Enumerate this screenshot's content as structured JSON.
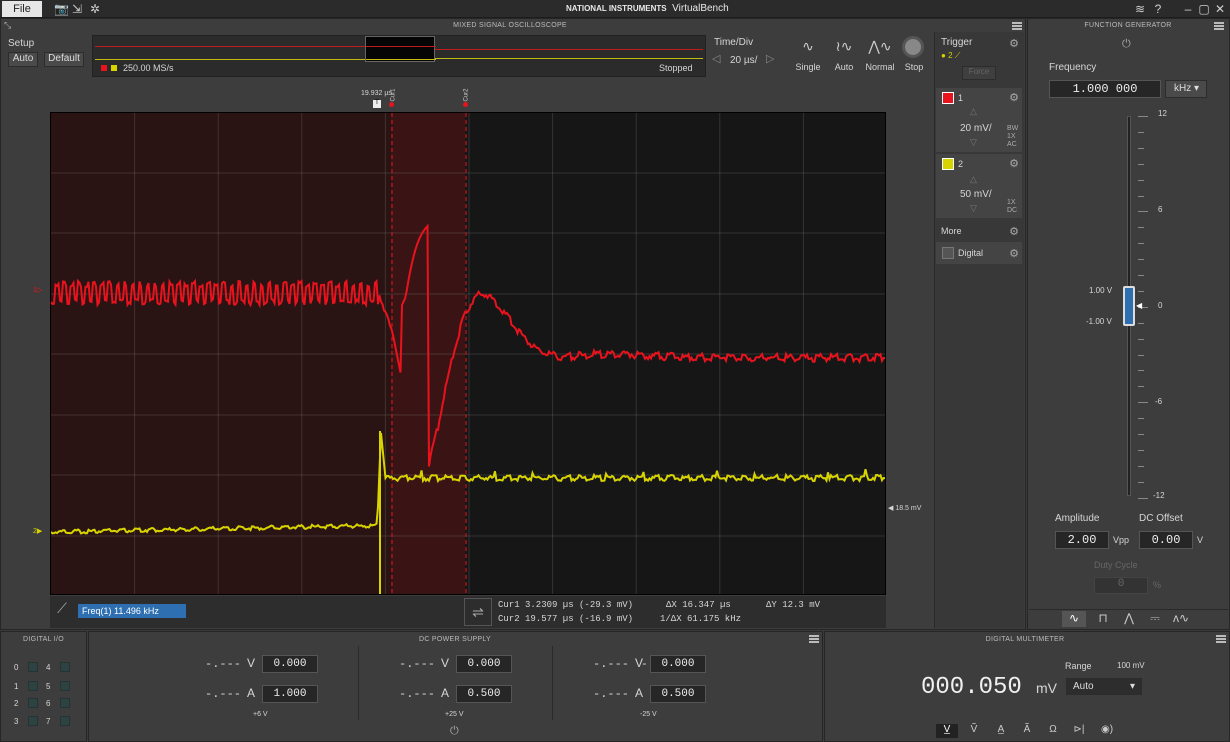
{
  "app": {
    "menu_file": "File",
    "title": "VirtualBench",
    "logo": "NATIONAL INSTRUMENTS"
  },
  "scope": {
    "panel_title": "MIXED SIGNAL OSCILLOSCOPE",
    "setup_label": "Setup",
    "auto_btn": "Auto",
    "default_btn": "Default",
    "sample_rate": "250.00 MS/s",
    "status": "Stopped",
    "timediv_label": "Time/Div",
    "timediv_value": "20 µs/",
    "modes": [
      "Single",
      "Auto",
      "Normal",
      "Stop"
    ],
    "trigger_label": "Trigger",
    "trigger_source": "2",
    "force_btn": "Force",
    "trigger_time": "19.932 µs",
    "trigger_level": "18.5 mV",
    "ch1": {
      "label": "1",
      "scale": "20 mV/",
      "bw": "BW",
      "probe": "1X",
      "coupling": "AC",
      "marker": "1",
      "color": "#e8131d"
    },
    "ch2": {
      "label": "2",
      "scale": "50 mV/",
      "probe": "1X",
      "coupling": "DC",
      "marker": "2",
      "color": "#d8d400"
    },
    "more_label": "More",
    "digital_label": "Digital",
    "cursor_labels": [
      "Cur1",
      "Cur2"
    ],
    "measure": {
      "label": "Freq(1)",
      "value": "11.496  kHz"
    },
    "cur1": "Cur1  3.2309 µs (-29.3 mV)",
    "cur2": "Cur2  19.577 µs (-16.9 mV)",
    "dx": "ΔX  16.347 µs",
    "inv_dx": "1/ΔX  61.175 kHz",
    "dy": "ΔY  12.3 mV"
  },
  "fgen": {
    "panel_title": "FUNCTION GENERATOR",
    "frequency_label": "Frequency",
    "frequency_value": "1.000 000",
    "frequency_unit": "kHz",
    "scale_ticks": [
      "12",
      "6",
      "0",
      "-6",
      "-12"
    ],
    "high_v": "1.00 V",
    "low_v": "-1.00 V",
    "amplitude_label": "Amplitude",
    "amplitude_value": "2.00",
    "amplitude_unit": "Vpp",
    "offset_label": "DC Offset",
    "offset_value": "0.00",
    "offset_unit": "V",
    "duty_label": "Duty Cycle",
    "duty_value": "0",
    "duty_unit": "%"
  },
  "dio": {
    "panel_title": "DIGITAL I/O",
    "pins": [
      "0",
      "1",
      "2",
      "3",
      "4",
      "5",
      "6",
      "7"
    ]
  },
  "psu": {
    "panel_title": "DC POWER SUPPLY",
    "channels": [
      {
        "v_read": "-.---",
        "v_unit": "V",
        "v_set": "0.000",
        "a_read": "-.---",
        "a_unit": "A",
        "a_set": "1.000",
        "name": "+6 V"
      },
      {
        "v_read": "-.---",
        "v_unit": "V",
        "v_set": "0.000",
        "a_read": "-.---",
        "a_unit": "A",
        "a_set": "0.500",
        "name": "+25 V"
      },
      {
        "v_read": "-.---",
        "v_unit": "V-",
        "v_set": "0.000",
        "a_read": "-.---",
        "a_unit": "A",
        "a_set": "0.500",
        "name": "-25 V"
      }
    ]
  },
  "dmm": {
    "panel_title": "DIGITAL MULTIMETER",
    "range_label": "Range",
    "range_value": "100 mV",
    "range_select": "Auto",
    "reading": "000.050",
    "unit": "mV"
  }
}
